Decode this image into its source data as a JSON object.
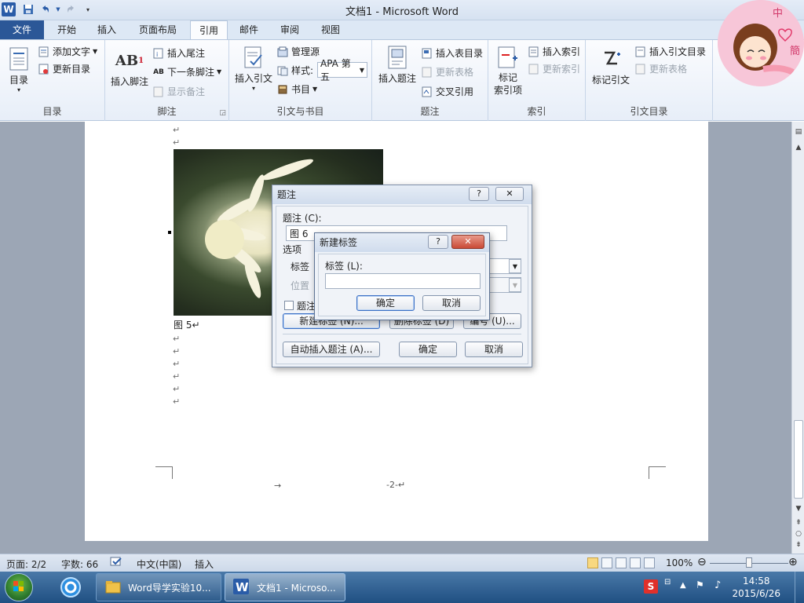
{
  "titlebar": {
    "title": "文档1 - Microsoft Word",
    "logo": "W",
    "save_icon": "save-icon",
    "undo_icon": "undo-icon",
    "redo_icon": "redo-icon",
    "customize_icon": "customize-qat-icon"
  },
  "tabs": [
    {
      "label": "文件",
      "state": "file"
    },
    {
      "label": "开始"
    },
    {
      "label": "插入"
    },
    {
      "label": "页面布局"
    },
    {
      "label": "引用",
      "state": "active"
    },
    {
      "label": "邮件"
    },
    {
      "label": "审阅"
    },
    {
      "label": "视图"
    }
  ],
  "ribbon": {
    "toc": {
      "label": "目录",
      "big_button": "目录",
      "add_text": "添加文字",
      "update_toc": "更新目录"
    },
    "footnotes": {
      "label": "脚注",
      "insert_footnote": "插入脚注",
      "insert_endnote": "插入尾注",
      "next_footnote": "下一条脚注",
      "show_notes": "显示备注"
    },
    "citations": {
      "label": "引文与书目",
      "insert_citation": "插入引文",
      "manage_sources": "管理源",
      "style_label": "样式:",
      "style_value": "APA 第五",
      "bibliography": "书目"
    },
    "captions": {
      "label": "题注",
      "insert_caption": "插入题注",
      "insert_table_of_figures": "插入表目录",
      "update_table": "更新表格",
      "cross_reference": "交叉引用"
    },
    "index": {
      "label": "索引",
      "mark_entry": "标记\n索引项",
      "insert_index": "插入索引",
      "update_index": "更新索引"
    },
    "toa": {
      "label": "引文目录",
      "mark_citation": "标记引文",
      "insert_toa": "插入引文目录",
      "update_table": "更新表格"
    },
    "avatar_text": [
      "中",
      "簡"
    ]
  },
  "document": {
    "caption": "图 5↵",
    "page_number": "-2-↵",
    "tab_arrow": "→",
    "para_mark": "↵"
  },
  "caption_dialog": {
    "title": "题注",
    "caption_label": "题注 (C):",
    "caption_value": "图 6",
    "options_label": "选项",
    "label_label": "标签",
    "position_label": "位置",
    "exclude_label": "题注",
    "new_label_button": "新建标签 (N)...",
    "delete_label_button": "删除标签 (D)",
    "numbering_button": "编号 (U)...",
    "auto_caption_button": "自动插入题注 (A)...",
    "ok_button": "确定",
    "cancel_button": "取消"
  },
  "new_label_dialog": {
    "title": "新建标签",
    "label_label": "标签 (L):",
    "label_value": "",
    "ok_button": "确定",
    "cancel_button": "取消"
  },
  "statusbar": {
    "page": "页面: 2/2",
    "words": "字数: 66",
    "language": "中文(中国)",
    "mode": "插入",
    "zoom": "100%",
    "zoom_level": 1.0
  },
  "taskbar": {
    "items": [
      {
        "label": "Word导学实验10..."
      },
      {
        "label": "文档1 - Microso..."
      }
    ],
    "time": "14:58",
    "date": "2015/6/26"
  },
  "colors": {
    "file_tab": "#2b5797",
    "doc_background": "#9ca6b5",
    "taskbar": "#1f4f82"
  }
}
